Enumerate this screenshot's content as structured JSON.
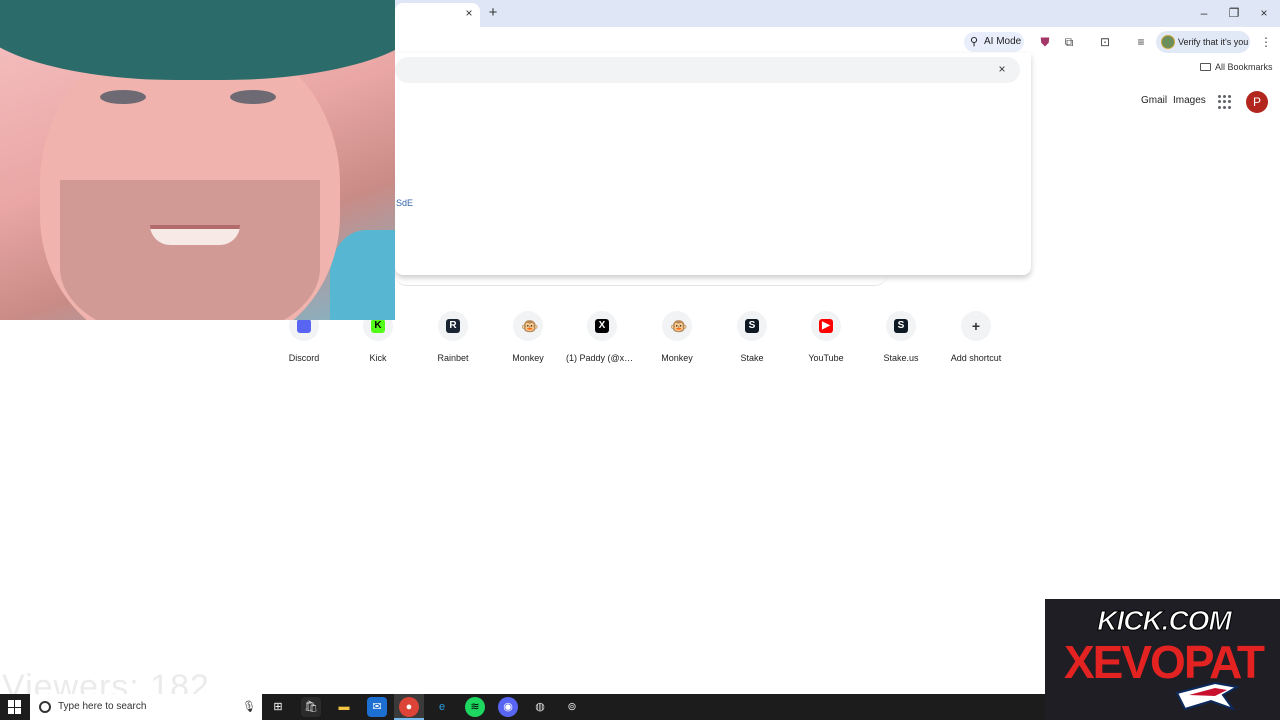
{
  "browser": {
    "tab_close": "×",
    "new_tab": "+",
    "window_minimize": "–",
    "window_restore": "❐",
    "window_close": "×",
    "ai_mode_label": "AI Mode",
    "verify_label": "Verify that it's you",
    "bookmarks_label": "All Bookmarks",
    "menu_icon": "⋮"
  },
  "popup": {
    "close": "×",
    "text": "SdE"
  },
  "google": {
    "gmail": "Gmail",
    "images": "Images",
    "profile_initial": "P"
  },
  "shortcuts": [
    {
      "label": "Discord",
      "glyph": "",
      "color": "#5865f2"
    },
    {
      "label": "Kick",
      "glyph": "K",
      "color": "#53fc18"
    },
    {
      "label": "Rainbet",
      "glyph": "R",
      "color": "#1b2433"
    },
    {
      "label": "Monkey",
      "glyph": "🐵",
      "color": "#f1f3f4"
    },
    {
      "label": "(1) Paddy (@xev...",
      "glyph": "X",
      "color": "#000000"
    },
    {
      "label": "Monkey",
      "glyph": "🐵",
      "color": "#f1f3f4"
    },
    {
      "label": "Stake",
      "glyph": "S",
      "color": "#0f1923"
    },
    {
      "label": "YouTube",
      "glyph": "▶",
      "color": "#ff0000"
    },
    {
      "label": "Stake.us",
      "glyph": "S",
      "color": "#0f1923"
    },
    {
      "label": "Add shortcut",
      "glyph": "+",
      "color": "#f1f3f4"
    }
  ],
  "overlay": {
    "viewers": "Viewers: 182",
    "kick_com": "KICK.COM",
    "channel": "XEVOPAT"
  },
  "taskbar": {
    "search_placeholder": "Type here to search"
  }
}
